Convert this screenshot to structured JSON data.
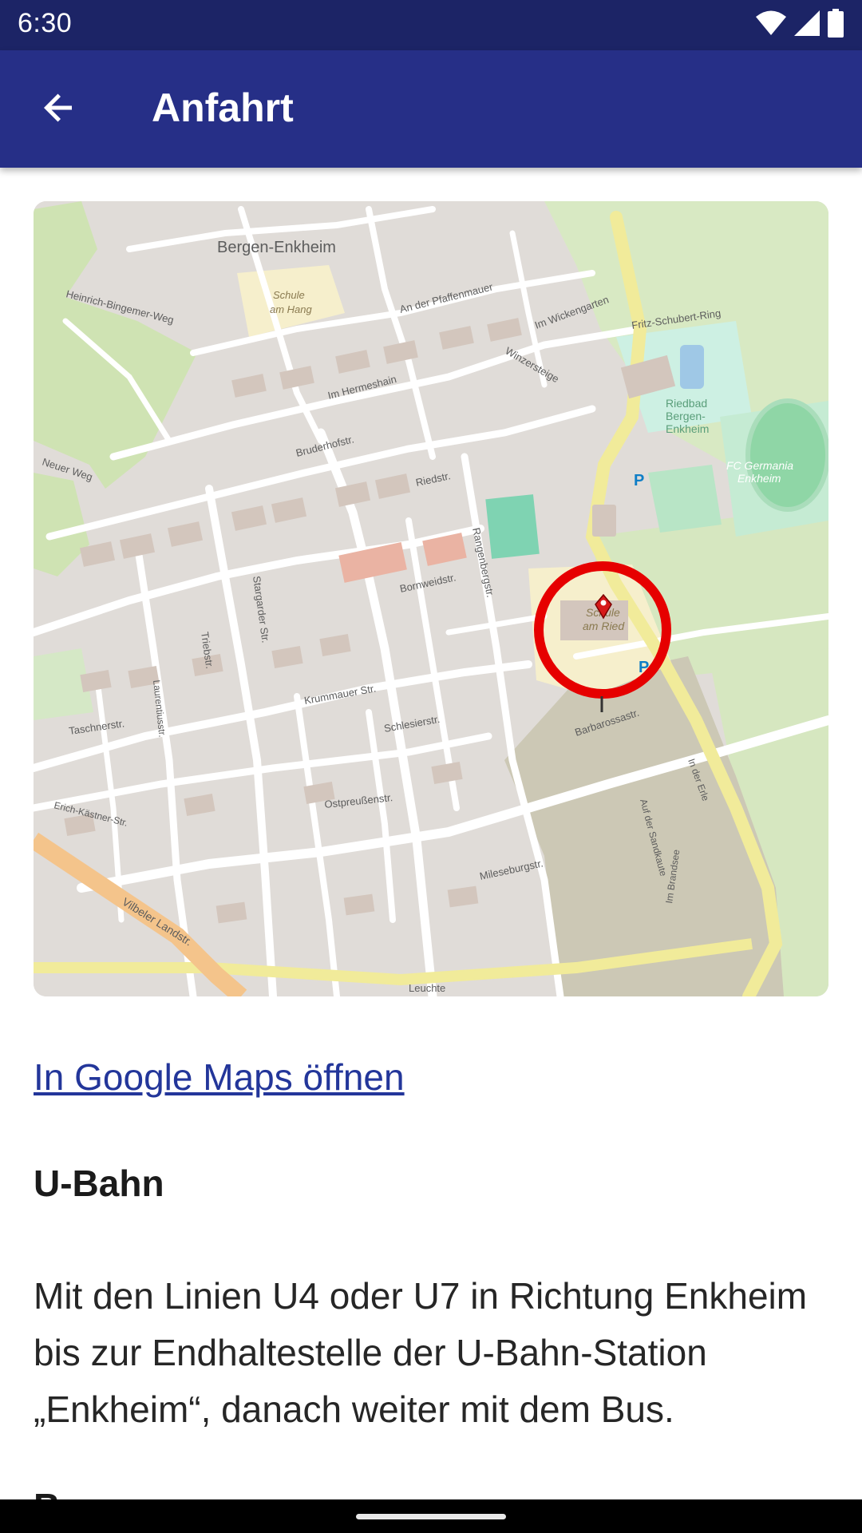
{
  "status_bar": {
    "time": "6:30",
    "icons": [
      "wifi-icon",
      "cellular-signal-icon",
      "battery-icon"
    ]
  },
  "app_bar": {
    "title": "Anfahrt",
    "back_icon": "arrow-back-icon"
  },
  "map": {
    "labels": {
      "district": "Bergen-Enkheim",
      "school_main_1": "Schule",
      "school_main_2": "am Ried",
      "school_hang_1": "Schule",
      "school_hang_2": "am Hang",
      "riedbad_1": "Riedbad",
      "riedbad_2": "Bergen-",
      "riedbad_3": "Enkheim",
      "fc_1": "FC Germania",
      "fc_2": "Enkheim",
      "street_riedstr": "Riedstr.",
      "street_bornweidstr": "Bornweidstr.",
      "street_barbarossastr": "Barbarossastr.",
      "street_leuchte": "Leuchte",
      "street_vilbeler": "Vilbeler Landstr.",
      "street_taschnerstr": "Taschnerstr.",
      "street_ostpreussenstr": "Ostpreußenstr.",
      "street_rangenbergstr": "Rangenbergstr.",
      "street_im_hermeshain": "Im Hermeshain",
      "street_bruderhofstr": "Bruderhofstr.",
      "street_krummauer": "Krummauer Str.",
      "street_schlesierstr": "Schlesierstr.",
      "street_winzersteige": "Winzersteige",
      "street_im_wickengarten": "Im Wickengarten",
      "street_an_der_pfaffenmauer": "An der Pfaffenmauer",
      "street_fritz_schubert": "Fritz-Schubert-Ring",
      "street_heinrich_bingemer": "Heinrich-Bingemer-Weg",
      "street_neuer_weg": "Neuer Weg",
      "street_triebstr": "Triebstr.",
      "street_stargarder": "Stargarder Str.",
      "street_mileseburgstr": "Mileseburgstr.",
      "street_erich_kaestner": "Erich-Kästner-Str.",
      "street_laurentiusstr": "Laurentiusstr.",
      "street_in_der_erle": "In der Erle",
      "street_im_brandsee": "Im Brandsee",
      "street_auf_der_sandkaute": "Auf der Sandkaute",
      "parking": "P"
    },
    "marker_icon": "location-pin-icon",
    "highlight_color": "#e60000"
  },
  "link": {
    "label": "In Google Maps öffnen",
    "color": "#23369a"
  },
  "sections": [
    {
      "heading": "U-Bahn",
      "body": "Mit den Linien U4 oder U7 in Richtung Enkheim bis zur Endhaltestelle der U-Bahn-Station „Enkheim“, danach weiter mit dem Bus."
    },
    {
      "heading": "Bus"
    }
  ],
  "colors": {
    "status_bar": "#1c2466",
    "app_bar": "#262f87"
  }
}
